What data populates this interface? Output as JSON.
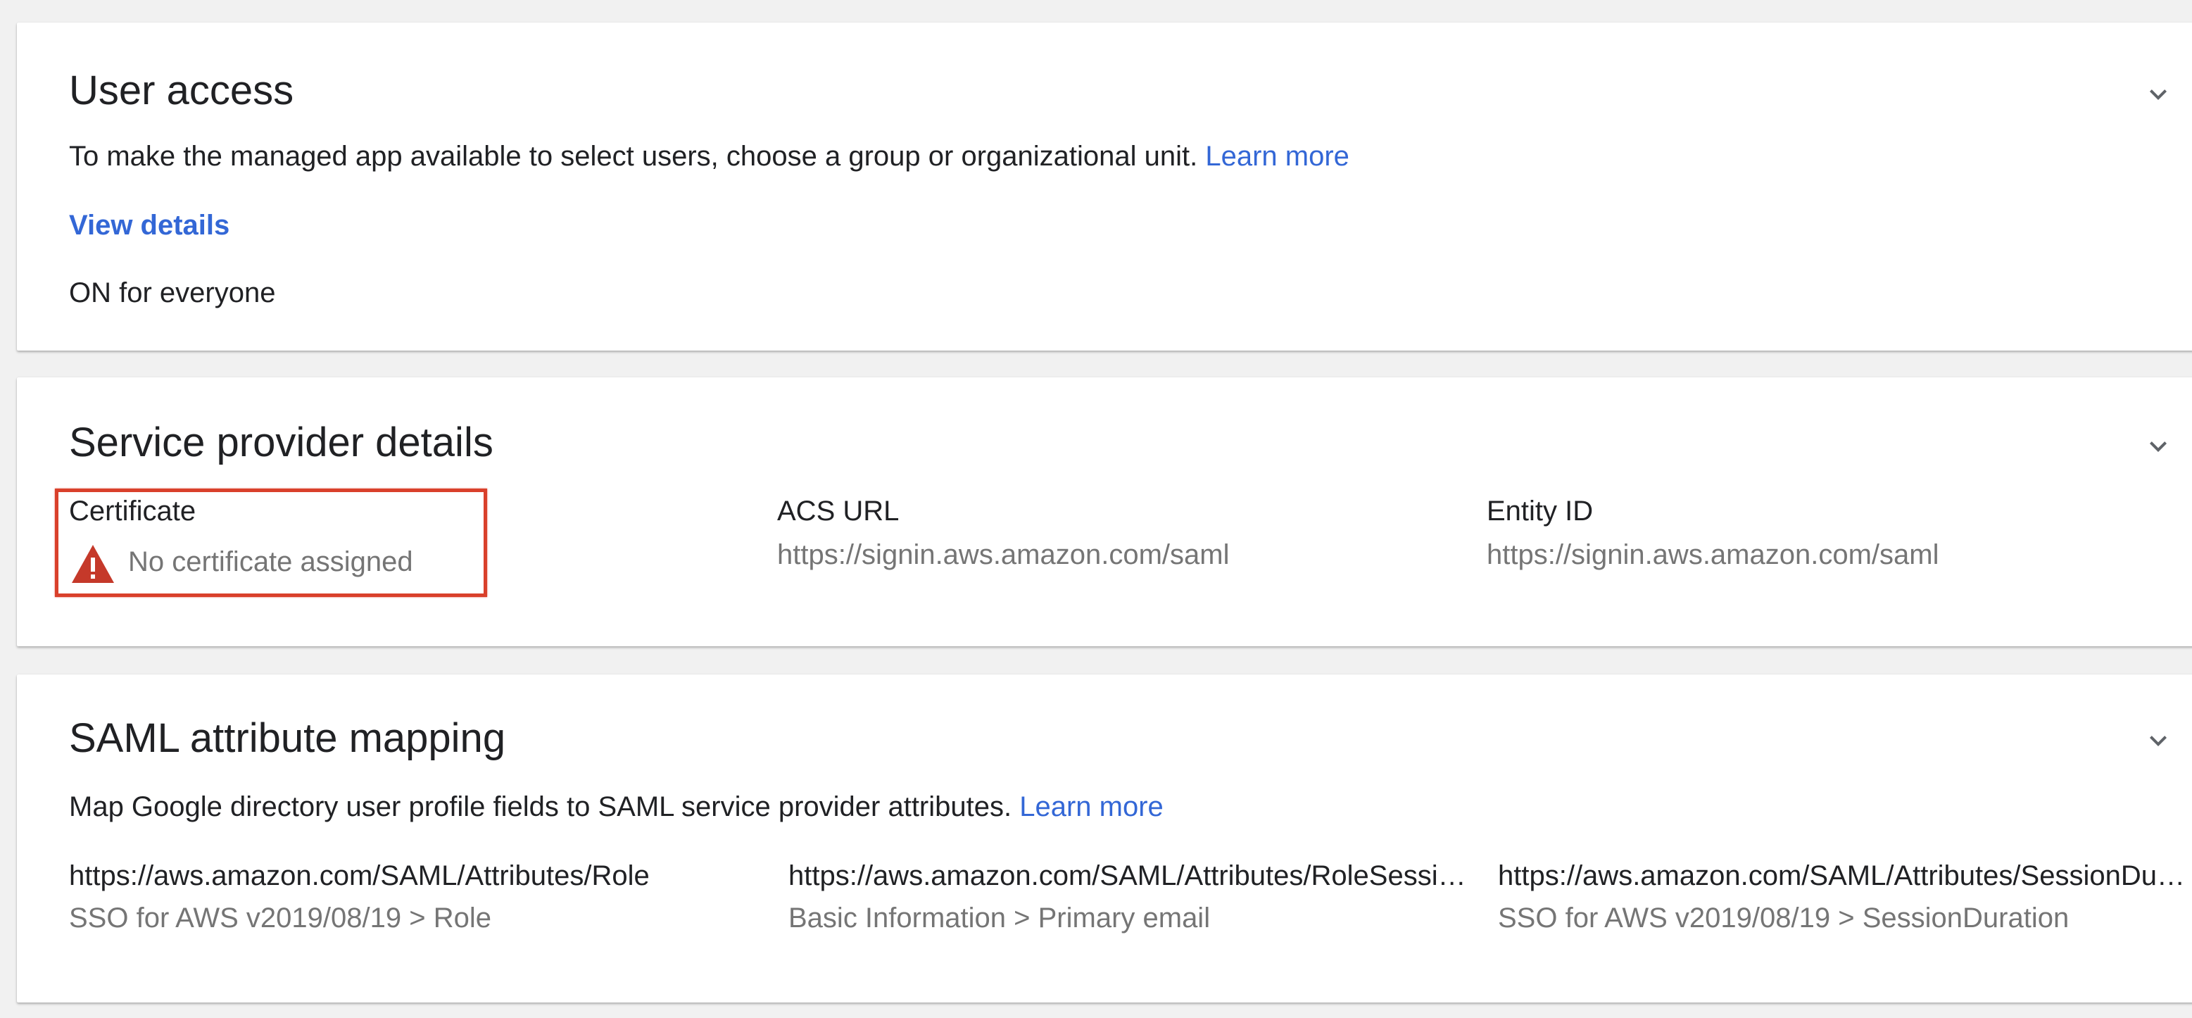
{
  "user_access": {
    "title": "User access",
    "description": "To make the managed app available to select users, choose a group or organizational unit.",
    "learn_more": "Learn more",
    "view_details": "View details",
    "status": "ON for everyone"
  },
  "service_provider": {
    "title": "Service provider details",
    "certificate_label": "Certificate",
    "certificate_value": "No certificate assigned",
    "acs_label": "ACS URL",
    "acs_value": "https://signin.aws.amazon.com/saml",
    "entity_label": "Entity ID",
    "entity_value": "https://signin.aws.amazon.com/saml"
  },
  "saml_mapping": {
    "title": "SAML attribute mapping",
    "description": "Map Google directory user profile fields to SAML service provider attributes.",
    "learn_more": "Learn more",
    "attributes": [
      {
        "name": "https://aws.amazon.com/SAML/Attributes/Role",
        "value": "SSO for AWS v2019/08/19 > Role"
      },
      {
        "name": "https://aws.amazon.com/SAML/Attributes/RoleSessionName",
        "value": "Basic Information > Primary email"
      },
      {
        "name": "https://aws.amazon.com/SAML/Attributes/SessionDuration",
        "value": "SSO for AWS v2019/08/19 > SessionDuration"
      }
    ]
  },
  "colors": {
    "link": "#3367d6",
    "highlight": "#d9402b",
    "warning": "#c5392a",
    "secondary_text": "#757575"
  },
  "icons": [
    "chevron-down-icon",
    "warning-icon"
  ]
}
